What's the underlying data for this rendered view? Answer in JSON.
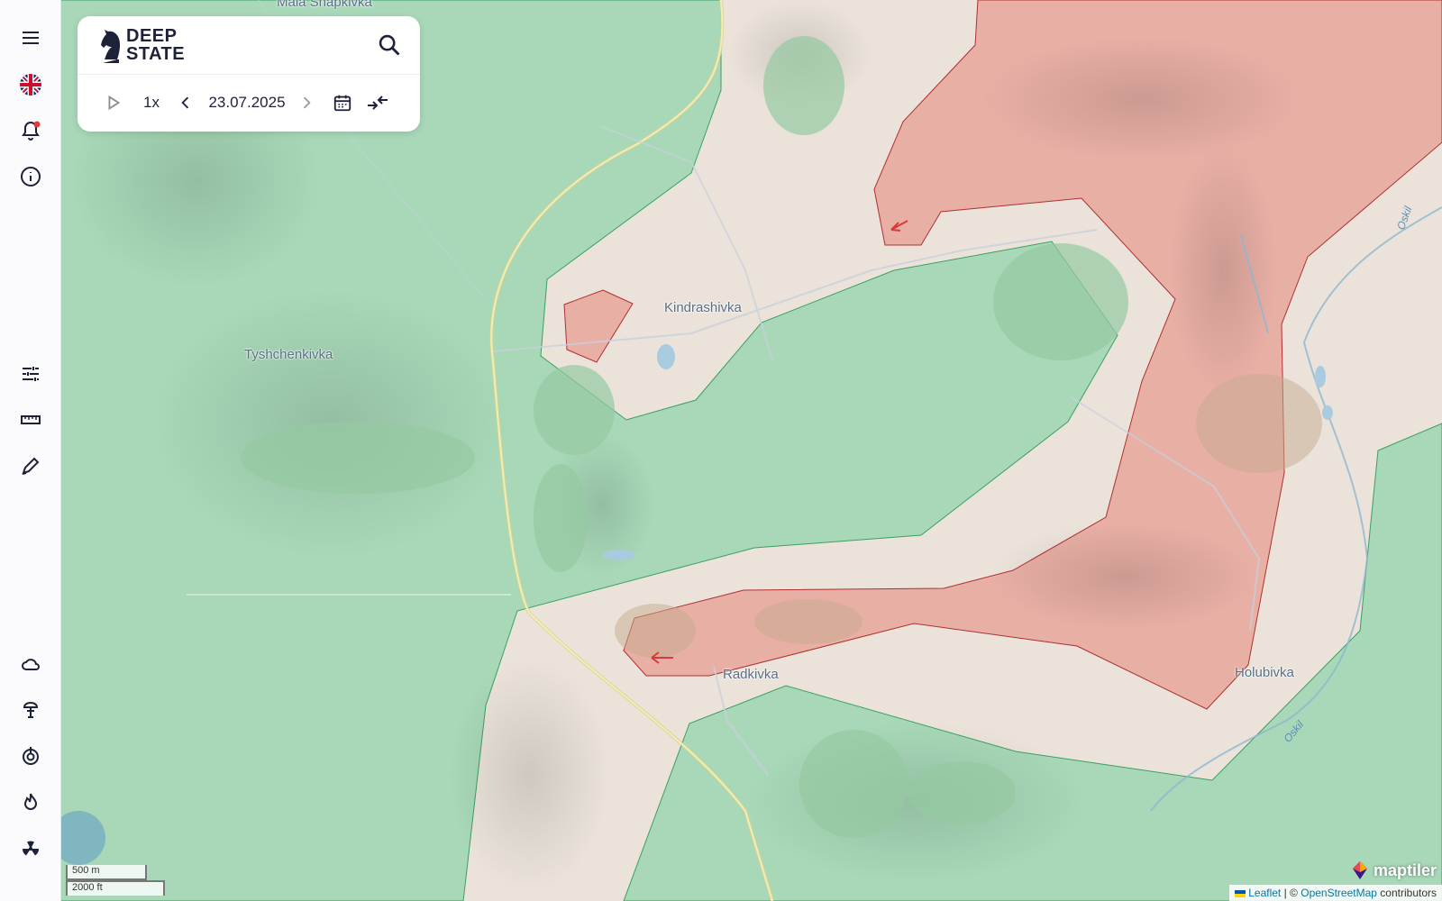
{
  "app": {
    "logo_line1": "DEEP",
    "logo_line2": "STATE"
  },
  "timeline": {
    "speed": "1x",
    "date": "23.07.2025"
  },
  "places": {
    "mala_shapkivka": "Mala Shapkivka",
    "kindrashivka": "Kindrashivka",
    "tyshchenkivka": "Tyshchenkivka",
    "radkivka": "Radkivka",
    "holubivka": "Holubivka",
    "river_oskil_1": "Oskil",
    "river_oskil_2": "Oskil"
  },
  "scale": {
    "metric": "500 m",
    "imperial": "2000 ft"
  },
  "attribution": {
    "leaflet": "Leaflet",
    "separator": "| ©",
    "osm": "OpenStreetMap",
    "contributors": "contributors",
    "maptiler": "maptiler"
  },
  "colors": {
    "controlled_area": "#a8d8b8",
    "occupied_area": "#e8a89e",
    "contested_area": "#ebe3da",
    "accent_notification": "#e53935"
  },
  "sidebar_icons": [
    "menu-icon",
    "uk-flag-icon",
    "bell-icon",
    "info-icon",
    "sliders-icon",
    "ruler-icon",
    "draw-icon",
    "cloud-icon",
    "explosion-icon",
    "target-icon",
    "fire-icon",
    "radiation-icon"
  ]
}
